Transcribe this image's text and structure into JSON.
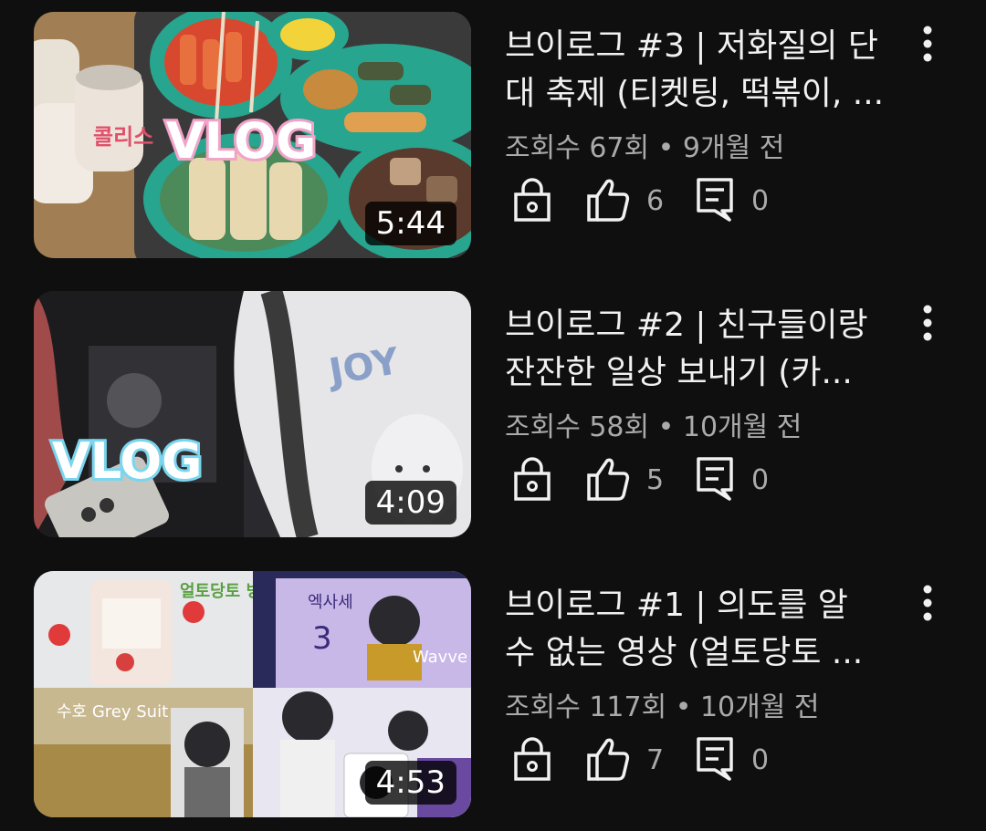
{
  "videos": [
    {
      "title": "브이로그 #3 | 저화질의 단\n대 축제 (티켓팅, 떡볶이, ...",
      "meta": "조회수 67회 • 9개월 전",
      "duration": "5:44",
      "likes": "6",
      "comments": "0",
      "thumbnail_text": "VLOG",
      "can_text": "콜리스"
    },
    {
      "title": "브이로그 #2 | 친구들이랑\n잔잔한 일상 보내기 (카...",
      "meta": "조회수 58회 • 10개월 전",
      "duration": "4:09",
      "likes": "5",
      "comments": "0",
      "thumbnail_text": "VLOG",
      "shirt_text": "JOY"
    },
    {
      "title": "브이로그 #1 | 의도를 알\n수 없는 영상 (얼토당토 ...",
      "meta": "조회수 117회 • 10개월 전",
      "duration": "4:53",
      "likes": "7",
      "comments": "0",
      "sticker_text": "얼토당토 빙토",
      "card_text": "엑사세",
      "card_number": "3",
      "card_brand": "Wavve",
      "poster_text": "수호 Grey Suit"
    }
  ],
  "icons": {
    "visibility": "lock-icon",
    "likes": "thumbs-up-icon",
    "comments": "comment-icon",
    "menu": "more-vertical-icon"
  }
}
